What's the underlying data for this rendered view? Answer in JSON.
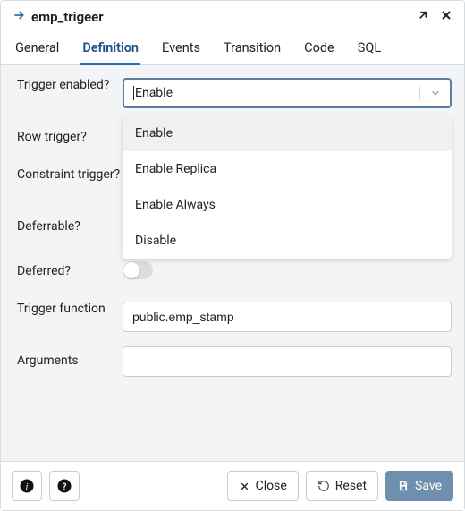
{
  "titlebar": {
    "title": "emp_trigeer"
  },
  "tabs": [
    {
      "label": "General",
      "active": false
    },
    {
      "label": "Definition",
      "active": true
    },
    {
      "label": "Events",
      "active": false
    },
    {
      "label": "Transition",
      "active": false
    },
    {
      "label": "Code",
      "active": false
    },
    {
      "label": "SQL",
      "active": false
    }
  ],
  "form": {
    "trigger_enabled": {
      "label": "Trigger enabled?",
      "value": "Enable",
      "options": [
        "Enable",
        "Enable Replica",
        "Enable Always",
        "Disable"
      ]
    },
    "row_trigger": {
      "label": "Row trigger?"
    },
    "constraint_trigger": {
      "label": "Constraint trigger?"
    },
    "deferrable": {
      "label": "Deferrable?"
    },
    "deferred": {
      "label": "Deferred?"
    },
    "trigger_function": {
      "label": "Trigger function",
      "value": "public.emp_stamp"
    },
    "arguments": {
      "label": "Arguments",
      "value": ""
    }
  },
  "footer": {
    "close": "Close",
    "reset": "Reset",
    "save": "Save"
  }
}
